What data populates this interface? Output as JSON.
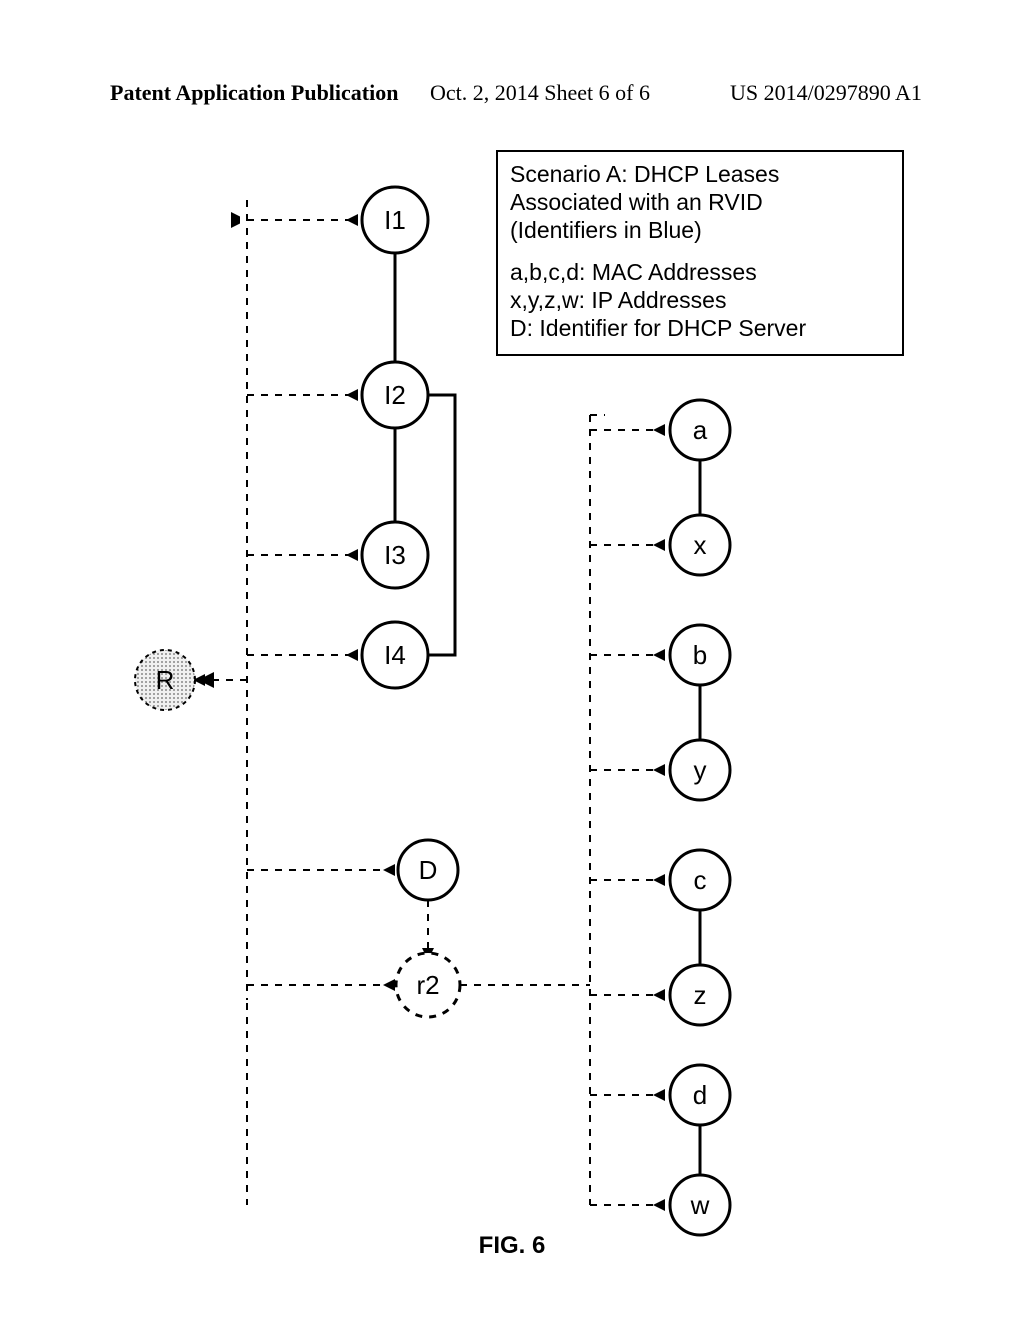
{
  "header": {
    "left": "Patent Application Publication",
    "center": "Oct. 2, 2014   Sheet 6 of 6",
    "right": "US 2014/0297890 A1"
  },
  "legend": {
    "title1": "Scenario A: DHCP Leases",
    "title2": "Associated with an RVID",
    "title3": "(Identifiers in Blue)",
    "line1": "a,b,c,d: MAC Addresses",
    "line2": "x,y,z,w: IP Addresses",
    "line3": "D: Identifier for DHCP Server"
  },
  "figure_caption": "FIG. 6",
  "nodes": {
    "R": "R",
    "I1": "I1",
    "I2": "I2",
    "I3": "I3",
    "I4": "I4",
    "D": "D",
    "r2": "r2",
    "a": "a",
    "x": "x",
    "b": "b",
    "y": "y",
    "c": "c",
    "z": "z",
    "d": "d",
    "w": "w"
  }
}
